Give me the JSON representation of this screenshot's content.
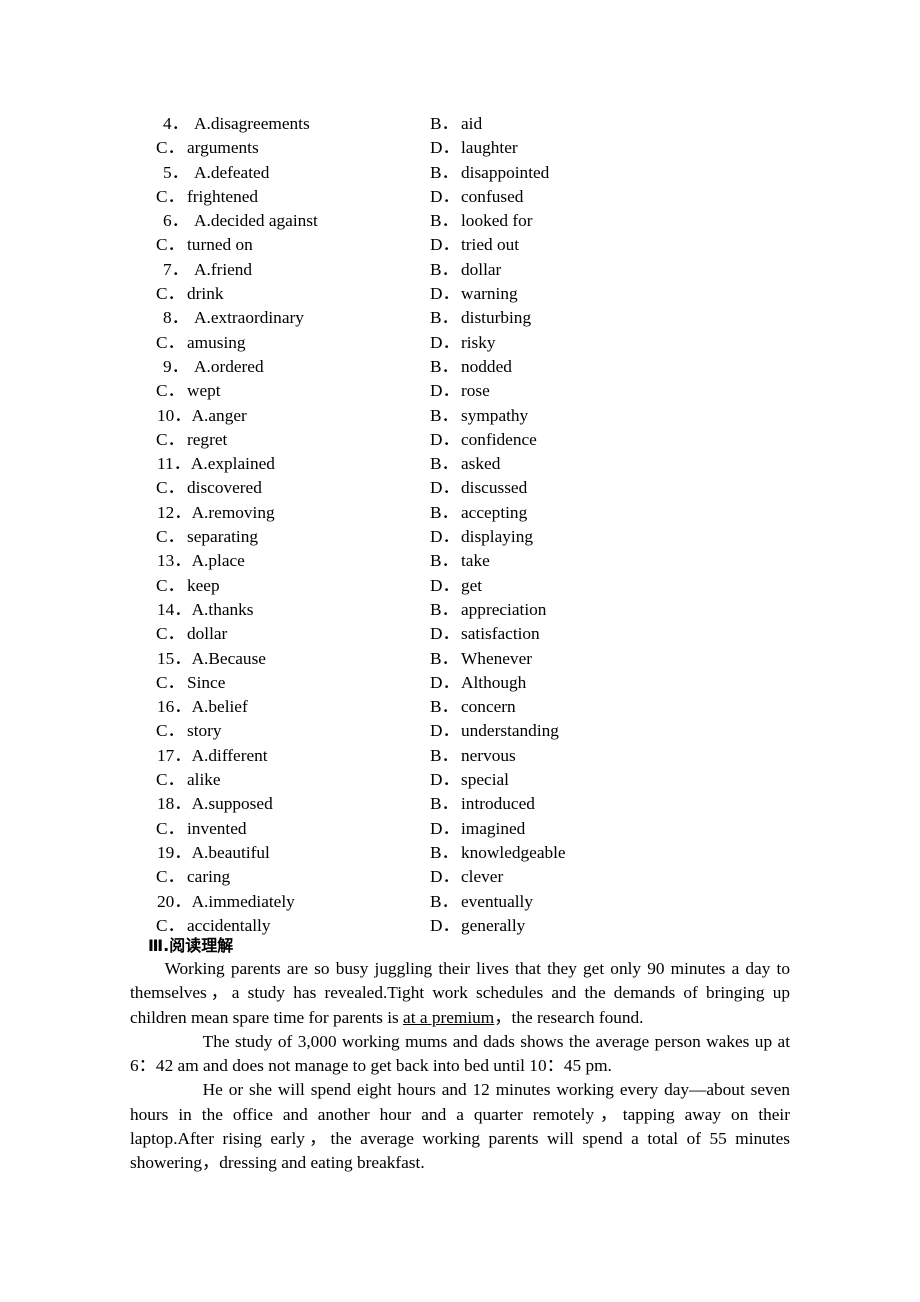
{
  "cloze_options": [
    {
      "number": "4．",
      "a_label": "A.",
      "a_text": "disagreements",
      "b_label": "B．",
      "b_text": "aid",
      "c_label": "C．",
      "c_text": "arguments",
      "d_label": "D．",
      "d_text": "laughter"
    },
    {
      "number": "5．",
      "a_label": "A.",
      "a_text": "defeated",
      "b_label": "B．",
      "b_text": "disappointed",
      "c_label": "C．",
      "c_text": "frightened",
      "d_label": "D．",
      "d_text": "confused"
    },
    {
      "number": "6．",
      "a_label": "A.",
      "a_text": "decided against",
      "b_label": "B．",
      "b_text": "looked for",
      "c_label": "C．",
      "c_text": "turned on",
      "d_label": "D．",
      "d_text": "tried out"
    },
    {
      "number": "7．",
      "a_label": "A.",
      "a_text": "friend",
      "b_label": "B．",
      "b_text": "dollar",
      "c_label": "C．",
      "c_text": "drink",
      "d_label": "D．",
      "d_text": "warning"
    },
    {
      "number": "8．",
      "a_label": "A.",
      "a_text": "extraordinary",
      "b_label": "B．",
      "b_text": "disturbing",
      "c_label": "C．",
      "c_text": "amusing",
      "d_label": "D．",
      "d_text": "risky"
    },
    {
      "number": "9．",
      "a_label": "A.",
      "a_text": "ordered",
      "b_label": "B．",
      "b_text": "nodded",
      "c_label": "C．",
      "c_text": "wept",
      "d_label": "D．",
      "d_text": "rose"
    },
    {
      "number": "10．",
      "a_label": "A.",
      "a_text": "anger",
      "b_label": "B．",
      "b_text": "sympathy",
      "c_label": "C．",
      "c_text": "regret",
      "d_label": "D．",
      "d_text": "confidence"
    },
    {
      "number": "11．",
      "a_label": "A.",
      "a_text": "explained",
      "b_label": "B．",
      "b_text": "asked",
      "c_label": "C．",
      "c_text": "discovered",
      "d_label": "D．",
      "d_text": "discussed"
    },
    {
      "number": "12．",
      "a_label": "A.",
      "a_text": "removing",
      "b_label": "B．",
      "b_text": "accepting",
      "c_label": "C．",
      "c_text": "separating",
      "d_label": "D．",
      "d_text": "displaying"
    },
    {
      "number": "13．",
      "a_label": "A.",
      "a_text": "place",
      "b_label": "B．",
      "b_text": "take",
      "c_label": "C．",
      "c_text": "keep",
      "d_label": "D．",
      "d_text": "get"
    },
    {
      "number": "14．",
      "a_label": "A.",
      "a_text": "thanks",
      "b_label": "B．",
      "b_text": "appreciation",
      "c_label": "C．",
      "c_text": "dollar",
      "d_label": "D．",
      "d_text": "satisfaction"
    },
    {
      "number": "15．",
      "a_label": "A.",
      "a_text": "Because",
      "b_label": "B．",
      "b_text": "Whenever",
      "c_label": "C．",
      "c_text": "Since",
      "d_label": "D．",
      "d_text": "Although"
    },
    {
      "number": "16．",
      "a_label": "A.",
      "a_text": "belief",
      "b_label": "B．",
      "b_text": "concern",
      "c_label": "C．",
      "c_text": "story",
      "d_label": "D．",
      "d_text": "understanding"
    },
    {
      "number": "17．",
      "a_label": "A.",
      "a_text": "different",
      "b_label": "B．",
      "b_text": "nervous",
      "c_label": "C．",
      "c_text": "alike",
      "d_label": "D．",
      "d_text": "special"
    },
    {
      "number": "18．",
      "a_label": "A.",
      "a_text": "supposed",
      "b_label": "B．",
      "b_text": "introduced",
      "c_label": "C．",
      "c_text": "invented",
      "d_label": "D．",
      "d_text": "imagined"
    },
    {
      "number": "19．",
      "a_label": "A.",
      "a_text": "beautiful",
      "b_label": "B．",
      "b_text": "knowledgeable",
      "c_label": "C．",
      "c_text": "caring",
      "d_label": "D．",
      "d_text": "clever"
    },
    {
      "number": "20．",
      "a_label": "A.",
      "a_text": "immediately",
      "b_label": "B．",
      "b_text": "eventually",
      "c_label": "C．",
      "c_text": "accidentally",
      "d_label": "D．",
      "d_text": "generally"
    }
  ],
  "reading_section": {
    "heading": "Ⅲ.阅读理解",
    "paragraphs": [
      {
        "indent": "small",
        "before_underline": "Working parents are so busy juggling their lives that they get only 90 minutes a day to themselves，a study has revealed.Tight work schedules and the demands of bringing up children mean spare time for parents is ",
        "underline": "at a premium",
        "after_underline": "，the research found."
      },
      {
        "indent": "large",
        "text": "The study of 3,000 working mums and dads shows the average person wakes up at 6：42 am and does not manage to get back into bed until 10：45 pm."
      },
      {
        "indent": "large",
        "text": "He or she will spend eight hours and 12 minutes working every day—about seven hours in the office and another hour and a quarter remotely，tapping away on their laptop.After rising early，the average working parents will spend a total of 55 minutes showering，dressing and eating breakfast."
      }
    ]
  }
}
